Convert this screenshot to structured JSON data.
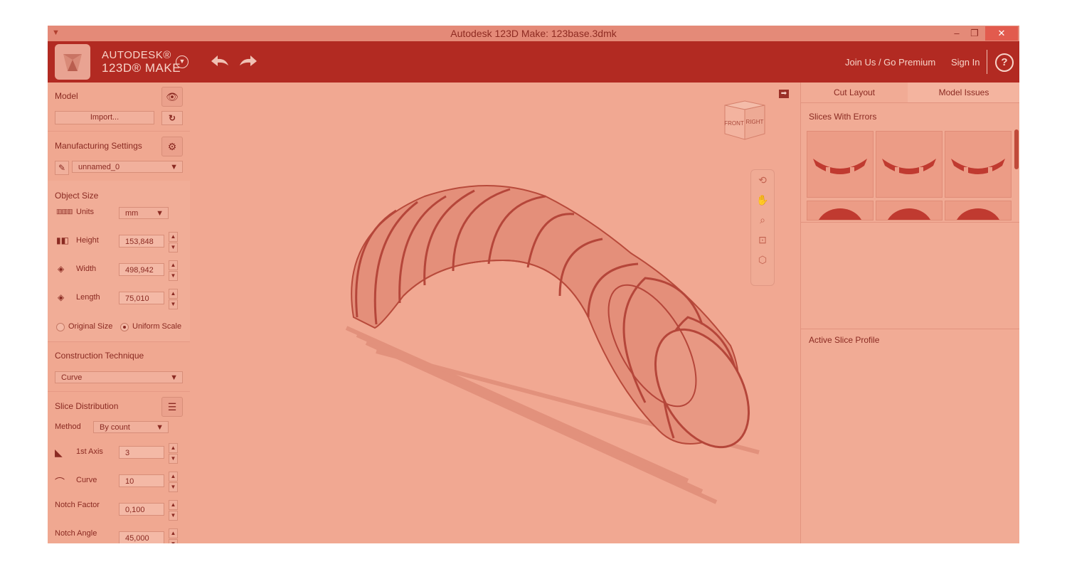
{
  "window": {
    "title": "Autodesk 123D Make: 123base.3dmk",
    "controls": {
      "minimize": "–",
      "maximize": "❐",
      "close": "✕"
    }
  },
  "header": {
    "brand_line1": "AUTODESK®",
    "brand_line2": "123D® MAKE",
    "undo_icon": "undo-arrow-icon",
    "redo_icon": "redo-arrow-icon",
    "join_label": "Join Us / Go Premium",
    "signin_label": "Sign In",
    "help_label": "?"
  },
  "left": {
    "model": {
      "title": "Model",
      "import_label": "Import..."
    },
    "manufacturing": {
      "title": "Manufacturing Settings",
      "profile_value": "unnamed_0"
    },
    "object_size": {
      "title": "Object Size",
      "units_label": "Units",
      "units_value": "mm",
      "height_label": "Height",
      "height_value": "153,848",
      "width_label": "Width",
      "width_value": "498,942",
      "length_label": "Length",
      "length_value": "75,010",
      "original_size_label": "Original Size",
      "uniform_scale_label": "Uniform Scale",
      "selected_scale": "uniform"
    },
    "construction": {
      "title": "Construction Technique",
      "value": "Curve"
    },
    "slice_distribution": {
      "title": "Slice Distribution",
      "method_label": "Method",
      "method_value": "By count",
      "axis1_label": "1st Axis",
      "axis1_value": "3",
      "curve_label": "Curve",
      "curve_value": "10",
      "notch_factor_label": "Notch Factor",
      "notch_factor_value": "0,100",
      "notch_angle_label": "Notch Angle",
      "notch_angle_value": "45,000"
    }
  },
  "viewport": {
    "navcube_front": "FRONT",
    "navcube_right": "RIGHT",
    "tools": [
      "orbit-icon",
      "pan-hand-icon",
      "zoom-icon",
      "fit-icon",
      "view-cube-icon"
    ]
  },
  "right": {
    "tabs": [
      {
        "label": "Cut Layout"
      },
      {
        "label": "Model Issues"
      }
    ],
    "active_tab": "Model Issues",
    "errors_title": "Slices With Errors",
    "profile_title": "Active Slice Profile"
  },
  "colors": {
    "header": "#b22a22",
    "panel": "#f0a891",
    "text": "#8a2a22"
  }
}
